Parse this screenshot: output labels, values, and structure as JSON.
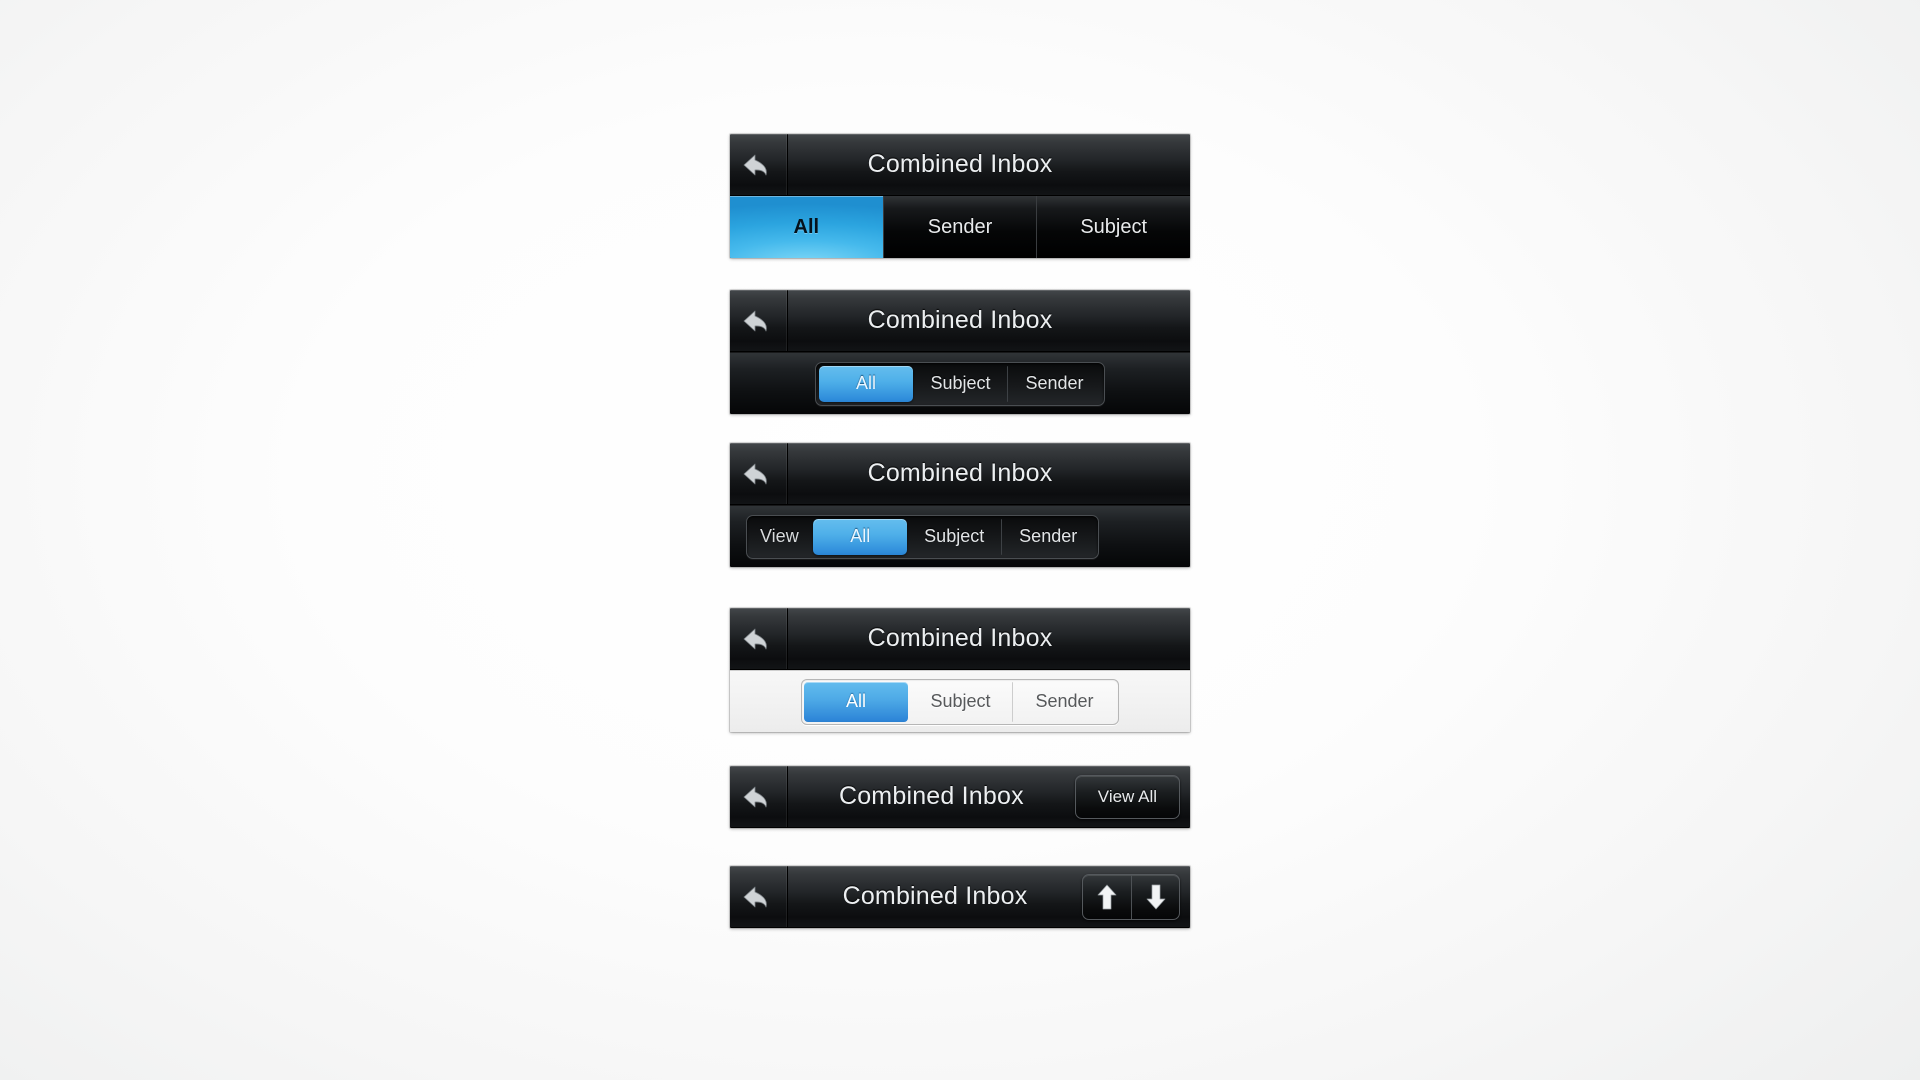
{
  "title": "Combined Inbox",
  "icons": {
    "back": "back-arrow-icon",
    "up": "arrow-up-icon",
    "down": "arrow-down-icon"
  },
  "colors": {
    "accent_light": "#62bcee",
    "accent_dark": "#2e86d8",
    "glow_cyan": "#45b9ec",
    "bar_dark": "#14171a",
    "bar_light": "#f2f2f2",
    "text_light": "#eceff1"
  },
  "variants": [
    {
      "name": "flat-tabs",
      "title": "Combined Inbox",
      "tabs": [
        {
          "label": "All",
          "active": true
        },
        {
          "label": "Sender",
          "active": false
        },
        {
          "label": "Subject",
          "active": false
        }
      ]
    },
    {
      "name": "dark-segmented",
      "title": "Combined Inbox",
      "tabs": [
        {
          "label": "All",
          "active": true
        },
        {
          "label": "Subject",
          "active": false
        },
        {
          "label": "Sender",
          "active": false
        }
      ]
    },
    {
      "name": "dark-segmented-with-label",
      "title": "Combined Inbox",
      "group_label": "View",
      "tabs": [
        {
          "label": "All",
          "active": true
        },
        {
          "label": "Subject",
          "active": false
        },
        {
          "label": "Sender",
          "active": false
        }
      ]
    },
    {
      "name": "light-segmented",
      "title": "Combined Inbox",
      "tabs": [
        {
          "label": "All",
          "active": true
        },
        {
          "label": "Subject",
          "active": false
        },
        {
          "label": "Sender",
          "active": false
        }
      ]
    },
    {
      "name": "action-button",
      "title": "Combined Inbox",
      "action_label": "View All"
    },
    {
      "name": "arrow-buttons",
      "title": "Combined Inbox"
    }
  ]
}
